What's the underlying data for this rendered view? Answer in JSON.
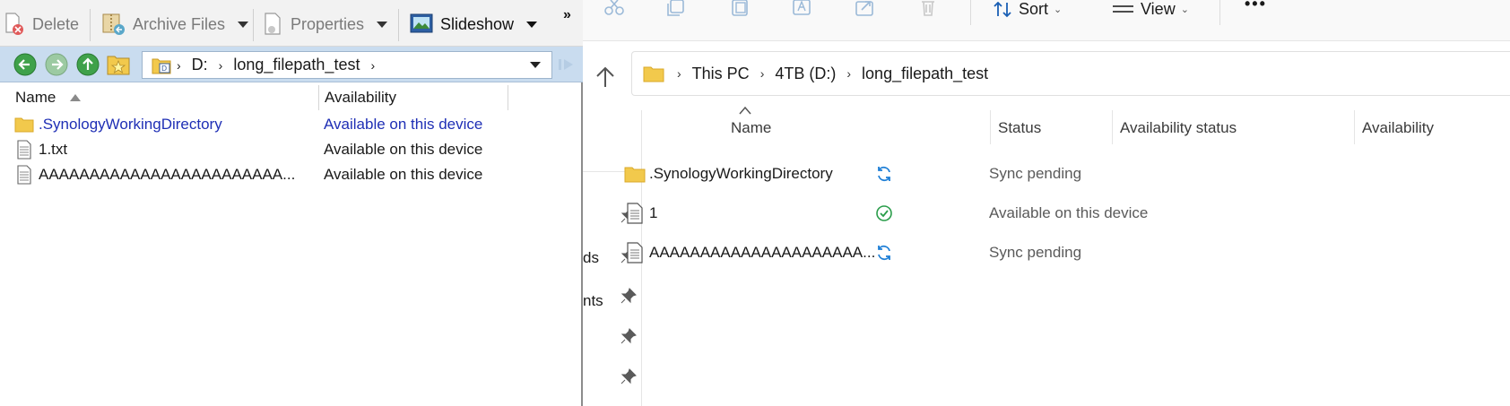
{
  "left_window": {
    "toolbar": {
      "delete_label": "Delete",
      "archive_label": "Archive Files",
      "properties_label": "Properties",
      "slideshow_label": "Slideshow",
      "more_label": "»"
    },
    "nav": {
      "path": [
        "D:",
        "long_filepath_test"
      ],
      "drive_glyph": "D"
    },
    "columns": {
      "name": "Name",
      "availability": "Availability"
    },
    "rows": [
      {
        "name": ".SynologyWorkingDirectory",
        "availability": "Available on this device",
        "icon": "folder-icon"
      },
      {
        "name": "1.txt",
        "availability": "Available on this device",
        "icon": "text-file-icon"
      },
      {
        "name": "AAAAAAAAAAAAAAAAAAAAAAAA...",
        "availability": "Available on this device",
        "icon": "text-file-icon"
      }
    ]
  },
  "right_window": {
    "commandbar": {
      "sort_label": "Sort",
      "view_label": "View",
      "more_label": "•••"
    },
    "breadcrumb": [
      "This PC",
      "4TB (D:)",
      "long_filepath_test"
    ],
    "nav_fragments": [
      "ds",
      "nts"
    ],
    "columns": {
      "name": "Name",
      "status": "Status",
      "availability_status": "Availability status",
      "availability": "Availability"
    },
    "rows": [
      {
        "name": ".SynologyWorkingDirectory",
        "status": "sync-pending-icon",
        "availability_status": "Sync pending",
        "icon": "folder-icon"
      },
      {
        "name": "1",
        "status": "available-check-icon",
        "availability_status": "Available on this device",
        "icon": "text-file-icon"
      },
      {
        "name": "AAAAAAAAAAAAAAAAAAAAA...",
        "status": "sync-pending-icon",
        "availability_status": "Sync pending",
        "icon": "text-file-icon"
      }
    ]
  },
  "colors": {
    "nav_bar": "#c9dcef",
    "link_blue": "#1f2fb5",
    "sync_blue": "#1f7fd6",
    "ok_green": "#2a9d4a",
    "folder_yellow": "#f2c94c"
  }
}
